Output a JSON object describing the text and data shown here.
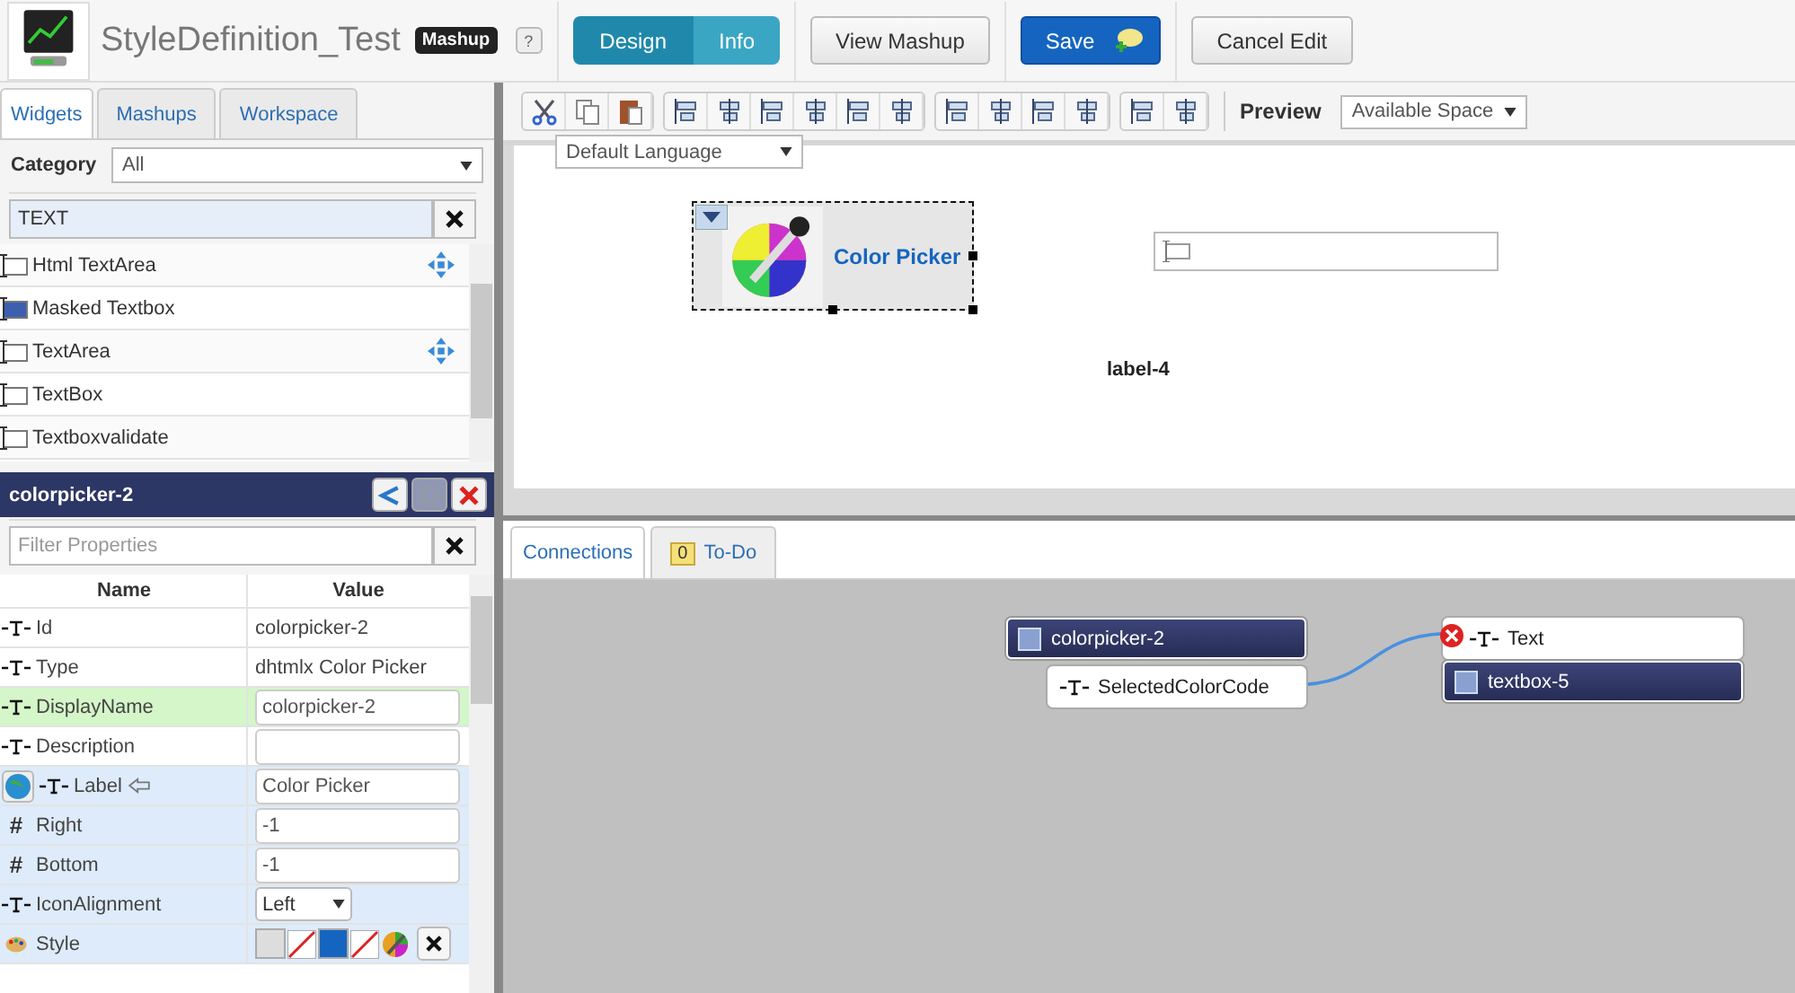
{
  "app": {
    "title": "StyleDefinition_Test",
    "badge": "Mashup",
    "help": "?"
  },
  "mode_tabs": [
    {
      "label": "Design",
      "selected": true
    },
    {
      "label": "Info",
      "selected": false
    }
  ],
  "header_buttons": [
    {
      "label": "View Mashup",
      "kind": "plain"
    },
    {
      "label": "Save",
      "kind": "primary"
    },
    {
      "label": "Cancel Edit",
      "kind": "plain"
    }
  ],
  "panel_tabs": [
    {
      "label": "Widgets",
      "selected": true
    },
    {
      "label": "Mashups",
      "selected": false
    },
    {
      "label": "Workspace",
      "selected": false
    }
  ],
  "category": {
    "label": "Category",
    "value": "All"
  },
  "widget_search": {
    "value": "TEXT"
  },
  "widgets": [
    {
      "name": "Html TextArea",
      "kind": "textarea",
      "responsive": true
    },
    {
      "name": "Masked Textbox",
      "kind": "masked",
      "responsive": false
    },
    {
      "name": "TextArea",
      "kind": "textarea",
      "responsive": true
    },
    {
      "name": "TextBox",
      "kind": "textbox",
      "responsive": false
    },
    {
      "name": "Textboxvalidate",
      "kind": "textbox",
      "responsive": false
    }
  ],
  "properties": {
    "title": "colorpicker-2",
    "filter": {
      "placeholder": "Filter Properties"
    },
    "columns": [
      "Name",
      "Value"
    ],
    "rows": [
      {
        "name": "Id",
        "kind": "plain",
        "value": "colorpicker-2",
        "selected": false,
        "bound": false,
        "localizable": false,
        "shaded": false
      },
      {
        "name": "Type",
        "kind": "plain",
        "value": "dhtmlx Color Picker",
        "selected": false,
        "bound": false,
        "localizable": false,
        "shaded": false
      },
      {
        "name": "DisplayName",
        "kind": "input",
        "value": "colorpicker-2",
        "selected": true,
        "bound": false,
        "localizable": false,
        "shaded": false
      },
      {
        "name": "Description",
        "kind": "input",
        "selected": false,
        "bound": false,
        "localizable": false,
        "shaded": false
      },
      {
        "name": "Label",
        "kind": "input",
        "value": "Color Picker",
        "selected": false,
        "bound": true,
        "localizable": true,
        "shaded": true
      },
      {
        "name": "Right",
        "kind": "input",
        "symbol": "#",
        "value": "-1",
        "selected": false,
        "bound": false,
        "localizable": false,
        "shaded": true
      },
      {
        "name": "Bottom",
        "kind": "input",
        "symbol": "#",
        "value": "-1",
        "selected": false,
        "bound": false,
        "localizable": false,
        "shaded": true
      },
      {
        "name": "IconAlignment",
        "kind": "select",
        "value": "Left",
        "selected": false,
        "bound": false,
        "localizable": false,
        "shaded": true
      },
      {
        "name": "Style",
        "kind": "style",
        "selected": false,
        "bound": false,
        "localizable": false,
        "shaded": true
      }
    ]
  },
  "toolbar": {
    "language": "Default Language",
    "preview_label": "Preview",
    "preview": "Available Space"
  },
  "canvas": {
    "widgets": [
      {
        "kind": "colorpicker",
        "label": "Color Picker",
        "selected": true
      },
      {
        "kind": "textbox",
        "selected": false
      },
      {
        "kind": "label",
        "label": "label-4",
        "selected": false
      }
    ]
  },
  "bottom_tabs": [
    {
      "label": "Connections",
      "selected": true
    },
    {
      "label": "To-Do",
      "selected": false,
      "count": "0"
    }
  ],
  "connections": {
    "source": {
      "name": "colorpicker-2",
      "property": "SelectedColorCode"
    },
    "target": {
      "name": "textbox-5",
      "property": "Text"
    }
  }
}
